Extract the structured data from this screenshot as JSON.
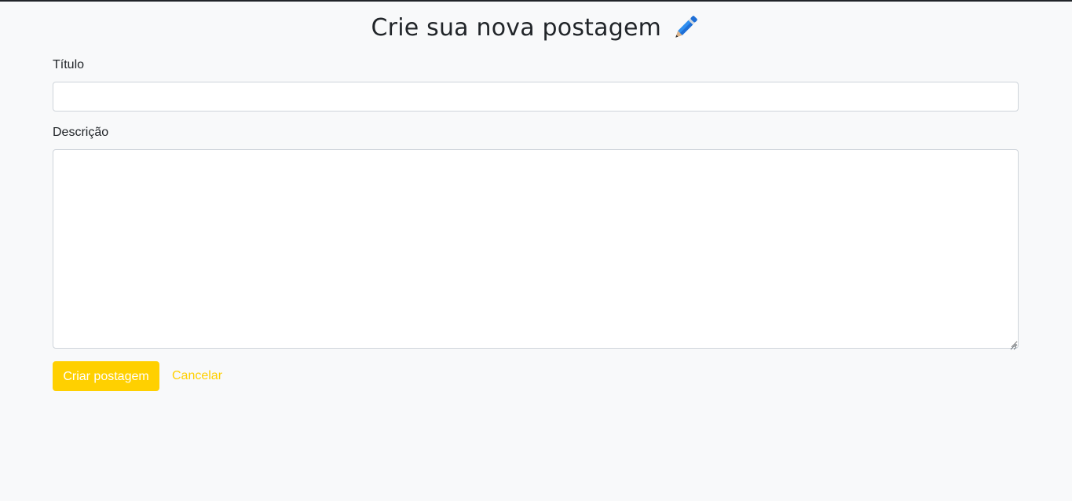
{
  "header": {
    "title": "Crie sua nova postagem",
    "icon": "pen-icon"
  },
  "form": {
    "title_label": "Título",
    "title_value": "",
    "description_label": "Descrição",
    "description_value": ""
  },
  "actions": {
    "create_label": "Criar postagem",
    "cancel_label": "Cancelar"
  },
  "colors": {
    "background": "#f8f9fa",
    "accent": "#ffd000",
    "text": "#212529",
    "input_border": "#ced4da"
  }
}
